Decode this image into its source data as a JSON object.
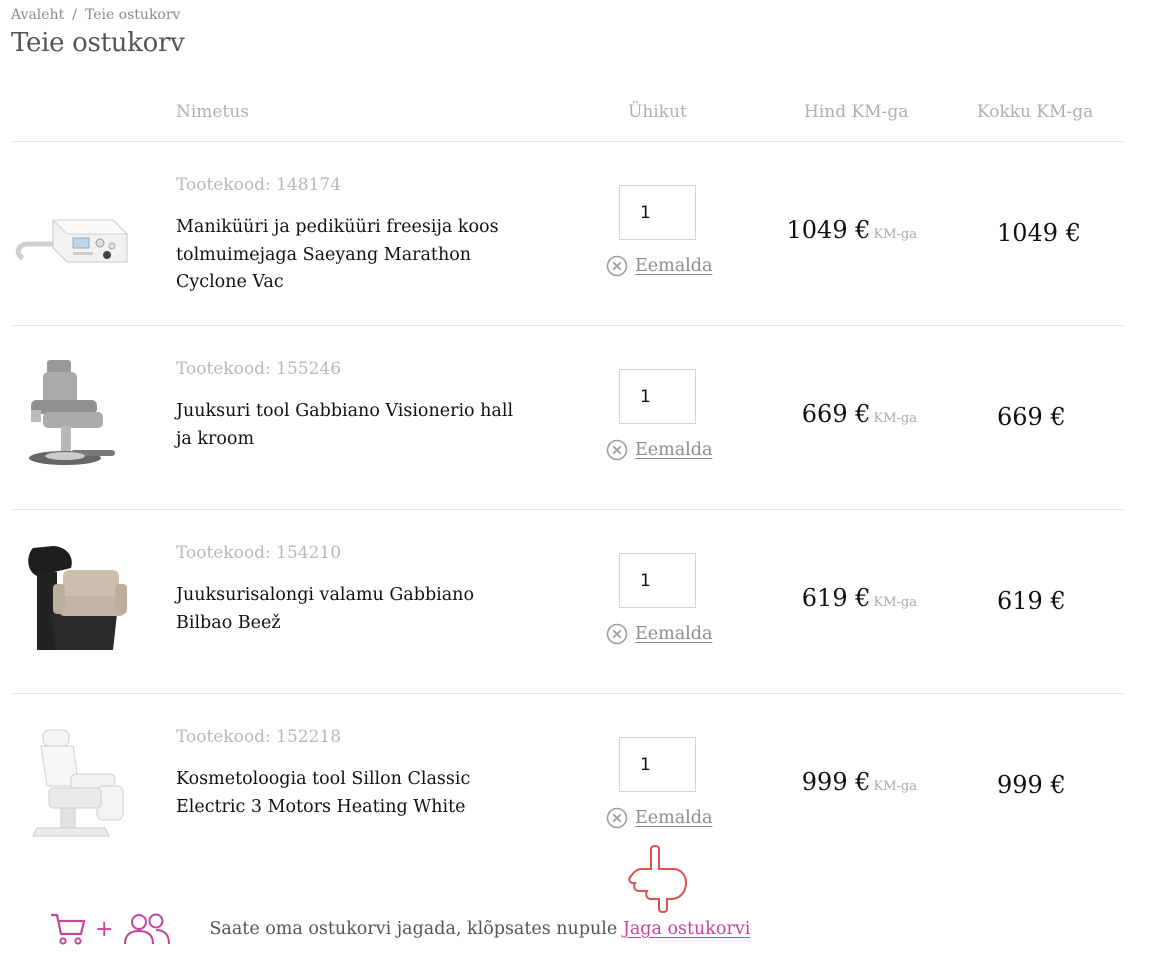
{
  "breadcrumb": {
    "home": "Avaleht",
    "current": "Teie ostukorv"
  },
  "page": {
    "title": "Teie ostukorv"
  },
  "table": {
    "headers": {
      "name": "Nimetus",
      "qty": "Ühikut",
      "price": "Hind KM-ga",
      "total": "Kokku KM-ga"
    }
  },
  "items": [
    {
      "code": "Tootekood: 148174",
      "name": "Maniküüri ja pediküüri freesija koos tolmuimejaga Saeyang Marathon Cyclone Vac",
      "qty": "1",
      "price": "1049 €",
      "price_unit": "KM-ga",
      "total": "1049 €",
      "remove": "Eemalda"
    },
    {
      "code": "Tootekood: 155246",
      "name": "Juuksuri tool Gabbiano Visionerio hall ja kroom",
      "qty": "1",
      "price": "669 €",
      "price_unit": "KM-ga",
      "total": "669 €",
      "remove": "Eemalda"
    },
    {
      "code": "Tootekood: 154210",
      "name": "Juuksurisalongi valamu Gabbiano Bilbao Beež",
      "qty": "1",
      "price": "619 €",
      "price_unit": "KM-ga",
      "total": "619 €",
      "remove": "Eemalda"
    },
    {
      "code": "Tootekood: 152218",
      "name": "Kosmetoloogia tool Sillon Classic Electric 3 Motors Heating White",
      "qty": "1",
      "price": "999 €",
      "price_unit": "KM-ga",
      "total": "999 €",
      "remove": "Eemalda"
    }
  ],
  "share": {
    "plus": "+",
    "text": "Saate oma ostukorvi jagada, klõpsates nupule",
    "link": "Jaga ostukorvi"
  },
  "colors": {
    "accent": "#c2459b",
    "hand": "#e0504f",
    "muted": "#b0b0b0"
  }
}
